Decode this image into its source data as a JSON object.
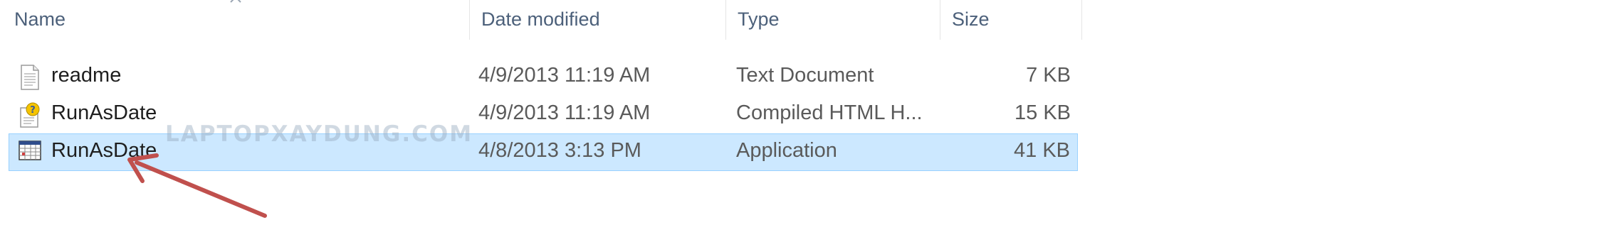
{
  "columns": {
    "name": "Name",
    "date_modified": "Date modified",
    "type": "Type",
    "size": "Size"
  },
  "files": [
    {
      "name": "readme",
      "date": "4/9/2013 11:19 AM",
      "type": "Text Document",
      "size": "7 KB",
      "icon": "text-document-icon",
      "selected": false
    },
    {
      "name": "RunAsDate",
      "date": "4/9/2013 11:19 AM",
      "type": "Compiled HTML H...",
      "size": "15 KB",
      "icon": "help-file-icon",
      "selected": false
    },
    {
      "name": "RunAsDate",
      "date": "4/8/2013 3:13 PM",
      "type": "Application",
      "size": "41 KB",
      "icon": "application-icon",
      "selected": true
    }
  ],
  "watermark": "LAPTOPXAYDUNG.COM",
  "colors": {
    "selection_fill": "#cce8ff",
    "selection_border": "#99d1ff",
    "header_text": "#4c607a",
    "annotation_arrow": "#c0504d"
  }
}
